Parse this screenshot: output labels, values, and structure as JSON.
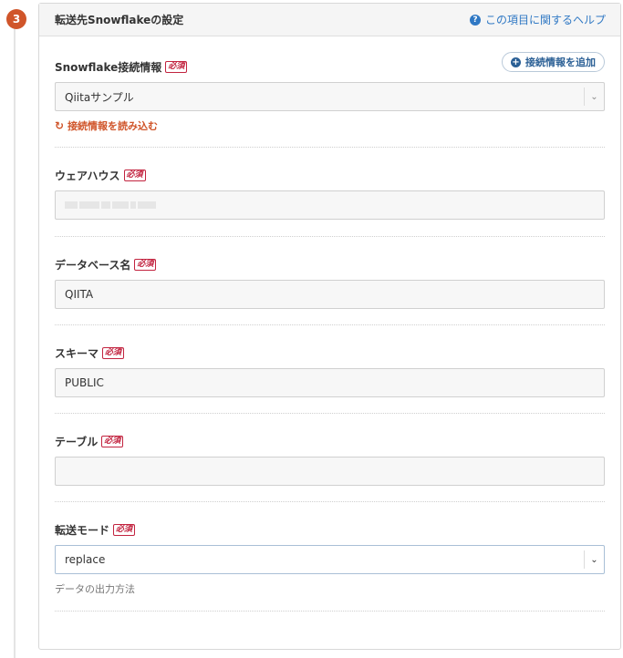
{
  "step": {
    "number": "3"
  },
  "panel": {
    "title": "転送先Snowflakeの設定",
    "help_label": "この項目に関するヘルプ",
    "help_icon": "question-circle-icon"
  },
  "required_label": "必須",
  "connection": {
    "label": "Snowflake接続情報",
    "add_button_label": "接続情報を追加",
    "add_icon": "plus-circle-icon",
    "selected_value": "Qiitaサンプル",
    "reload_label": "接続情報を読み込む",
    "reload_icon": "refresh-icon"
  },
  "warehouse": {
    "label": "ウェアハウス",
    "value": ""
  },
  "database": {
    "label": "データベース名",
    "value": "QIITA"
  },
  "schema": {
    "label": "スキーマ",
    "value": "PUBLIC"
  },
  "table": {
    "label": "テーブル",
    "value": ""
  },
  "transfer_mode": {
    "label": "転送モード",
    "selected_value": "replace",
    "hint": "データの出力方法"
  },
  "colors": {
    "accent_orange": "#d0552a",
    "link_blue": "#2f78c4",
    "required_red": "#c2233f"
  }
}
